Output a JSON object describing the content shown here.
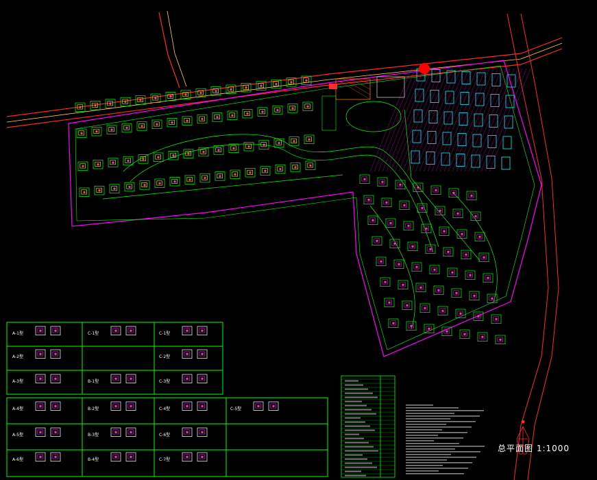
{
  "drawing": {
    "title": "总平面图 1:1000"
  },
  "legend_table": {
    "rows": [
      [
        "A-1型",
        "C-1型",
        "C-1型"
      ],
      [
        "A-2型",
        "",
        "C-2型"
      ],
      [
        "A-3型",
        "B-1型",
        "C-3型"
      ],
      [
        "A-4型",
        "B-2型",
        "C-4型",
        "C-5型"
      ],
      [
        "A-5型",
        "B-3型",
        "C-6型"
      ],
      [
        "A-6型",
        "B-4型",
        "C-7型"
      ]
    ]
  },
  "colors": {
    "background": "#000000",
    "road": "#ff2a2a",
    "green": "#00ff00",
    "cyan": "#00ffff",
    "magenta": "#ff00ff",
    "yellow": "#ffff00",
    "white": "#ffffff",
    "red_marker": "#ff0000"
  }
}
